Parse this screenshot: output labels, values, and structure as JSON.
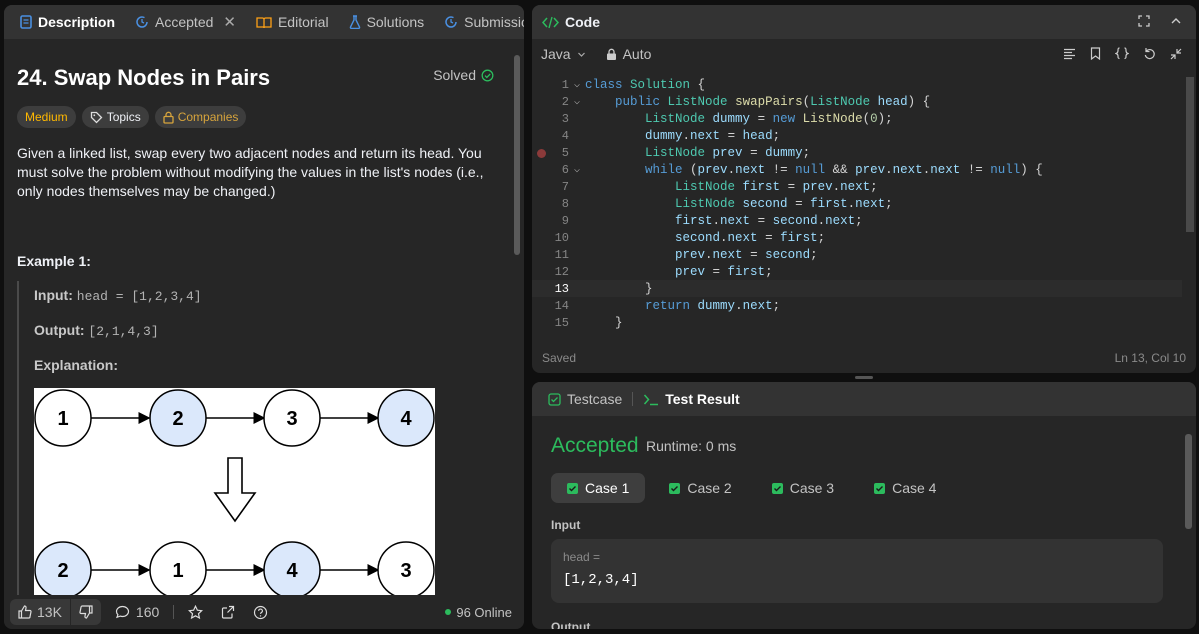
{
  "left_tabs": [
    {
      "label": "Description",
      "icon": "description-icon"
    },
    {
      "label": "Accepted",
      "icon": "history-icon"
    },
    {
      "label": "Editorial",
      "icon": "book-icon"
    },
    {
      "label": "Solutions",
      "icon": "flask-icon"
    },
    {
      "label": "Submissions",
      "icon": "history-icon"
    }
  ],
  "problem": {
    "title": "24. Swap Nodes in Pairs",
    "solved": "Solved",
    "difficulty": "Medium",
    "topics": "Topics",
    "companies": "Companies",
    "description": "Given a linked list, swap every two adjacent nodes and return its head. You must solve the problem without modifying the values in the list's nodes (i.e., only nodes themselves may be changed.)",
    "example_heading": "Example 1:",
    "input_label": "Input:",
    "input_value": "head = [1,2,3,4]",
    "output_label": "Output:",
    "output_value": "[2,1,4,3]",
    "explanation_label": "Explanation:",
    "diagram_top": [
      "1",
      "2",
      "3",
      "4"
    ],
    "diagram_bottom": [
      "2",
      "1",
      "4",
      "3"
    ]
  },
  "footer": {
    "likes": "13K",
    "comments": "160",
    "online": "96 Online"
  },
  "code": {
    "title": "Code",
    "language": "Java",
    "mode": "Auto",
    "saved": "Saved",
    "cursor": "Ln 13, Col 10",
    "current_line": 13,
    "breakpoint_line": 5
  },
  "result": {
    "tabs": [
      "Testcase",
      "Test Result"
    ],
    "status": "Accepted",
    "runtime": "Runtime: 0 ms",
    "cases": [
      "Case 1",
      "Case 2",
      "Case 3",
      "Case 4"
    ],
    "input_heading": "Input",
    "input_key": "head =",
    "input_value": "[1,2,3,4]",
    "output_heading": "Output"
  },
  "colors": {
    "accent_green": "#2cbb5d",
    "medium": "#ffb800",
    "highlight_node": "#dbe8fb"
  }
}
